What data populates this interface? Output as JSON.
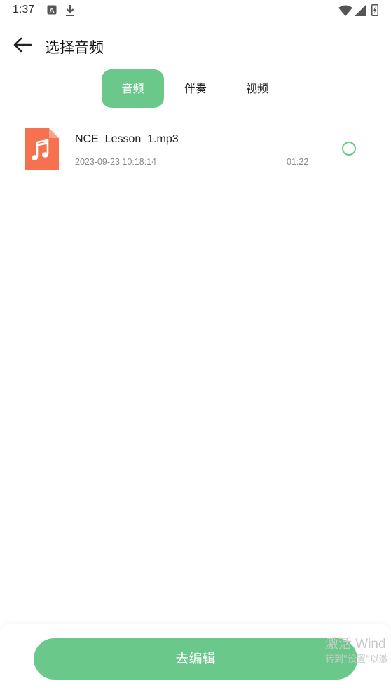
{
  "status_bar": {
    "time": "1:37",
    "icons": [
      "a-notification-icon",
      "download-icon",
      "wifi-icon",
      "signal-icon",
      "battery-icon"
    ]
  },
  "header": {
    "title": "选择音频",
    "back_icon": "arrow-left-icon"
  },
  "tabs": [
    {
      "label": "音频",
      "active": true
    },
    {
      "label": "伴奏",
      "active": false
    },
    {
      "label": "视频",
      "active": false
    }
  ],
  "audio_list": [
    {
      "name": "NCE_Lesson_1.mp3",
      "date": "2023-09-23 10:18:14",
      "duration": "01:22",
      "icon": "music-file-icon",
      "selected": false
    }
  ],
  "bottom": {
    "edit_button_label": "去编辑",
    "watermark_line1": "激活 Wind",
    "watermark_line2": "转到\"设置\"以激"
  },
  "colors": {
    "accent": "#6ac98a",
    "file_icon": "#f5714f"
  }
}
